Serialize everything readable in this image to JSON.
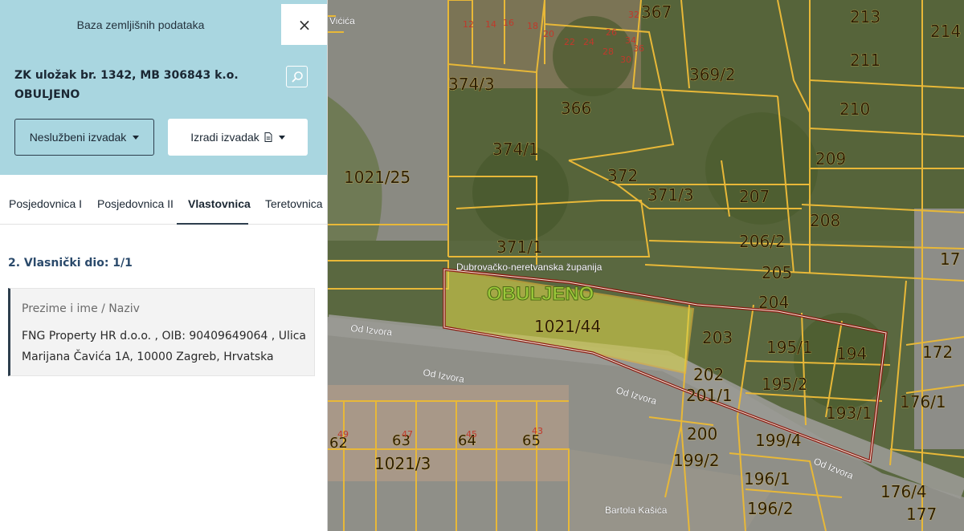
{
  "panel": {
    "header_title": "Baza zemljišnih podataka",
    "close_symbol": "×",
    "parcel_title": "ZK uložak br. 1342, MB 306843 k.o. OBULJENO",
    "buttons": {
      "unofficial_extract": "Neslužbeni izvadak",
      "create_extract": "Izradi izvadak"
    },
    "tabs": [
      {
        "label": "Posjedovnica I",
        "active": false
      },
      {
        "label": "Posjedovnica II",
        "active": false
      },
      {
        "label": "Vlastovnica",
        "active": true
      },
      {
        "label": "Teretovnica",
        "active": false
      }
    ],
    "ownership": {
      "share_title": "2. Vlasnički dio: 1/1",
      "field_label": "Prezime i ime / Naziv",
      "owner": "FNG Property HR d.o.o. , OIB: 90409649064 , Ulica Marijana Čavića 1A, 10000 Zagreb, Hrvatska"
    }
  },
  "map": {
    "cadastral_municipality": "OBULJENO",
    "region_label": "Dubrovačko-neretvanska županija",
    "streets": [
      "Od Izvora",
      "Od Izvora",
      "Od Izvora",
      "Od Izvora",
      "Bartola Kašića",
      "Vićića"
    ],
    "parcels": [
      "367",
      "213",
      "214",
      "369/2",
      "211",
      "374/3",
      "366",
      "210",
      "374/1",
      "209",
      "1021/25",
      "372",
      "371/3",
      "207",
      "208",
      "206/2",
      "371/1",
      "205",
      "204",
      "1021/44",
      "203",
      "195/1",
      "194",
      "172",
      "202",
      "195/2",
      "201/1",
      "176/1",
      "193/1",
      "200",
      "199/4",
      "199/2",
      "196/1",
      "196/2",
      "176/4",
      "177",
      "1021/3",
      "62",
      "63",
      "64",
      "65",
      "17"
    ],
    "house_numbers": [
      "12",
      "14",
      "16",
      "18",
      "20",
      "22",
      "24",
      "26",
      "28",
      "30",
      "32",
      "34",
      "36",
      "47",
      "45",
      "43",
      "49"
    ],
    "highlight_color": "#8b1a10",
    "parcel_line_color": "#e8b838",
    "selected_fill": "#d8d24a"
  }
}
